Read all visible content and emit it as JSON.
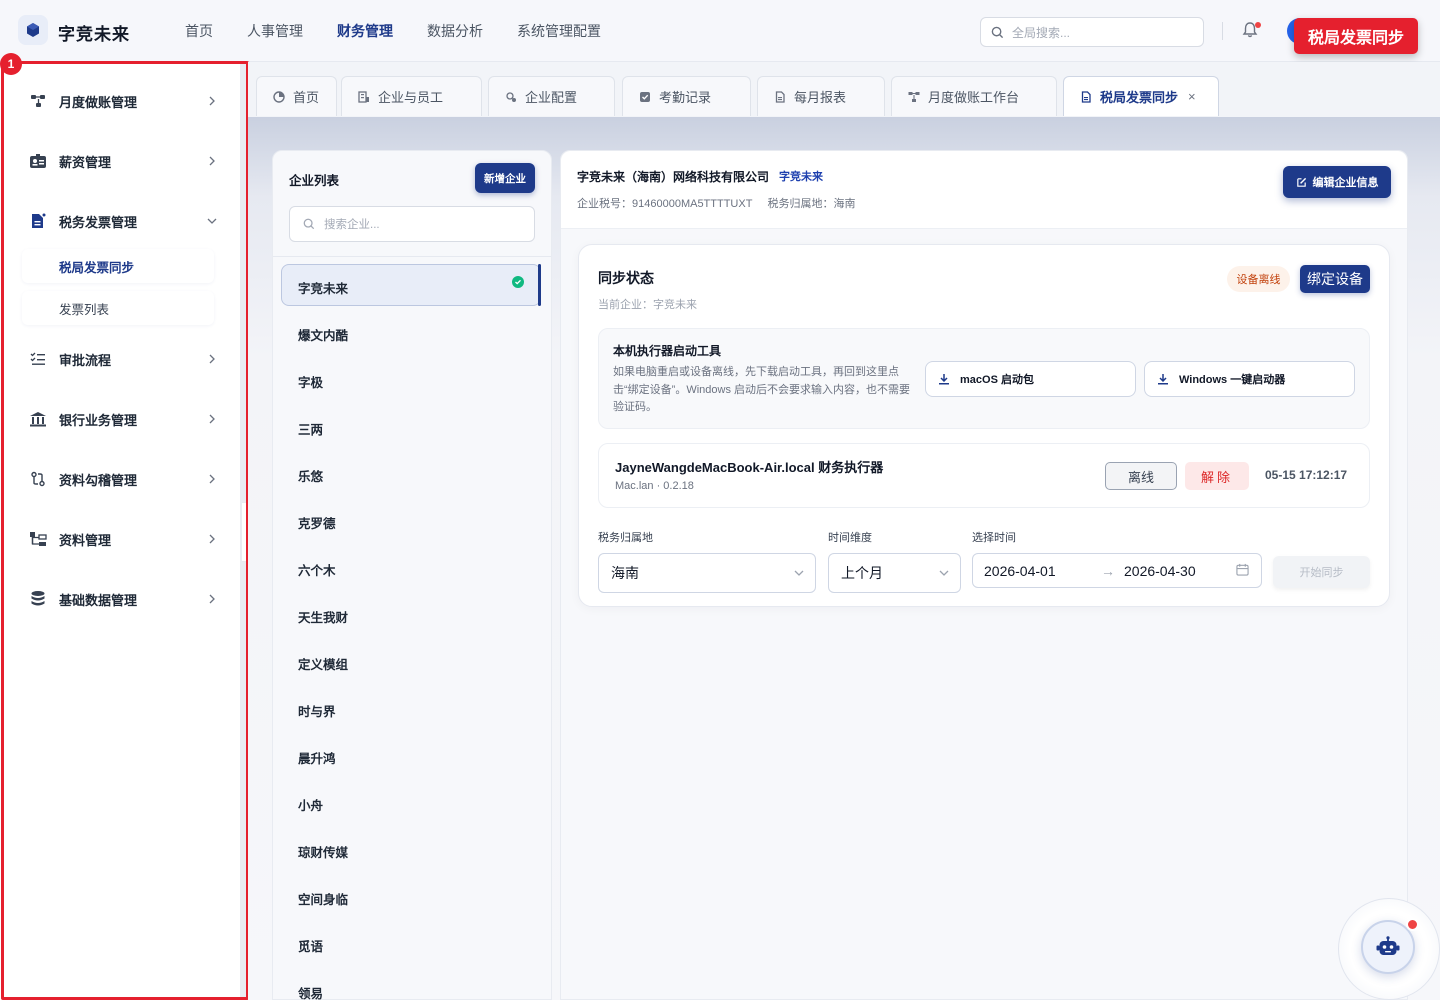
{
  "app": {
    "brand": "字竞未来",
    "topnav": [
      "首页",
      "人事管理",
      "财务管理",
      "数据分析",
      "系统管理配置"
    ],
    "topnav_active_index": 2,
    "search_placeholder": "全局搜索...",
    "callout": "税局发票同步",
    "highlight_badge": "1"
  },
  "sidebar": {
    "items": [
      {
        "label": "月度做账管理",
        "icon": "flow-icon"
      },
      {
        "label": "薪资管理",
        "icon": "id-card-icon"
      },
      {
        "label": "税务发票管理",
        "icon": "invoice-icon",
        "expanded": true
      },
      {
        "label": "审批流程",
        "icon": "checklist-icon"
      },
      {
        "label": "银行业务管理",
        "icon": "bank-icon"
      },
      {
        "label": "资料勾稽管理",
        "icon": "link-icon"
      },
      {
        "label": "资料管理",
        "icon": "folder-tree-icon"
      },
      {
        "label": "基础数据管理",
        "icon": "database-icon"
      }
    ],
    "subitems": [
      "税局发票同步",
      "发票列表"
    ],
    "active_sub": "税局发票同步"
  },
  "tabs": [
    {
      "label": "首页",
      "icon": "home-icon"
    },
    {
      "label": "企业与员工",
      "icon": "company-icon"
    },
    {
      "label": "企业配置",
      "icon": "settings-icon"
    },
    {
      "label": "考勤记录",
      "icon": "check-icon"
    },
    {
      "label": "每月报表",
      "icon": "doc-icon"
    },
    {
      "label": "月度做账工作台",
      "icon": "flow-icon"
    },
    {
      "label": "税局发票同步",
      "icon": "doc-icon",
      "active": true,
      "close": "×"
    }
  ],
  "company_list": {
    "title": "企业列表",
    "new_button": "新增企业",
    "search_placeholder": "搜索企业...",
    "items": [
      "字竞未来",
      "爆文内酷",
      "字极",
      "三两",
      "乐悠",
      "克罗德",
      "六个木",
      "天生我财",
      "定义模组",
      "时与界",
      "晨升鸿",
      "小舟",
      "琼财传媒",
      "空间身临",
      "觅语",
      "领易"
    ],
    "selected": "字竞未来"
  },
  "company": {
    "name": "字竞未来（海南）网络科技有限公司",
    "short_tag": "字竞未来",
    "tax_id": "企业税号：91460000MA5TTTTUXT",
    "tax_region": "税务归属地：海南",
    "edit_button": "编辑企业信息"
  },
  "sync": {
    "title": "同步状态",
    "current": "当前企业：字竞未来",
    "status_badge": "设备离线",
    "bind_button": "绑定设备",
    "tool_title": "本机执行器启动工具",
    "tool_desc": "如果电脑重启或设备离线，先下载启动工具，再回到这里点击“绑定设备”。Windows 启动后不会要求输入内容，也不需要验证码。",
    "mac_button": "macOS 启动包",
    "win_button": "Windows 一键启动器",
    "executor_name": "JayneWangdeMacBook-Air.local 财务执行器",
    "executor_sub": "Mac.lan · 0.2.18",
    "offline_button": "离线",
    "unbind_button": "解除",
    "executor_time": "05-15 17:12:17",
    "region_label": "税务归属地",
    "region_value": "海南",
    "dimension_label": "时间维度",
    "dimension_value": "上个月",
    "time_label": "选择时间",
    "date_start": "2026-04-01",
    "date_end": "2026-04-30",
    "start_button": "开始同步"
  }
}
